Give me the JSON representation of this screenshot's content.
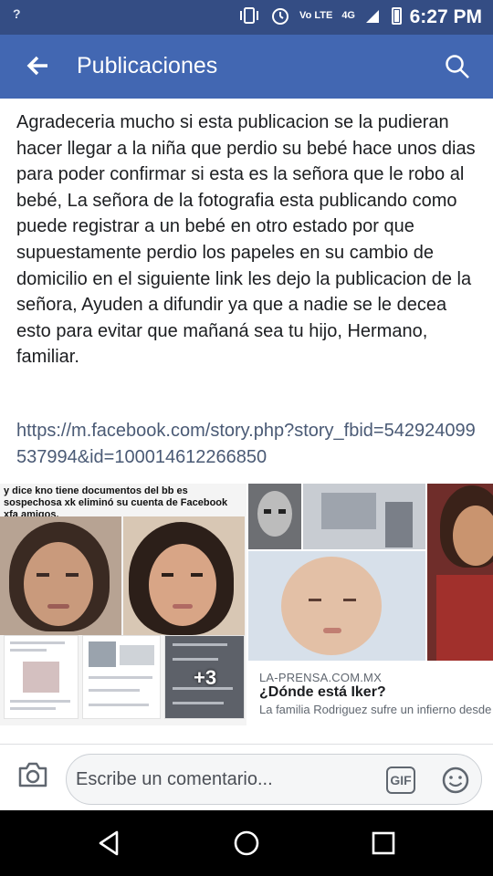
{
  "status_bar": {
    "signal_left": "?",
    "network": "Vo LTE",
    "network_4g": "4G",
    "time": "6:27 PM",
    "icons": [
      "vibrate-icon",
      "alarm-icon",
      "signal-icon",
      "battery-icon"
    ]
  },
  "app_bar": {
    "title": "Publicaciones",
    "back_icon": "arrow-left-icon",
    "search_icon": "search-icon",
    "background": "#4267b2"
  },
  "post": {
    "text": "Agradeceria mucho si esta publicacion se la pudieran hacer llegar a la niña que perdio su bebé hace unos dias para poder confirmar si esta es la señora que le robo al bebé, La señora de la fotografia esta publicando como puede registrar a un bebé en otro estado por que supuestamente perdio los papeles en su cambio de domicilio en el siguiente link les dejo la publicacion de la señora, Ayuden a difundir ya que a nadie se le decea esto para evitar que mañaná sea tu hijo, Hermano, familiar.",
    "link": "https://m.facebook.com/story.php?story_fbid=542924099537994&id=100014612266850"
  },
  "attachment_left": {
    "caption": "y dice kno tiene documentos del bb es sospechosa xk eliminó su cuenta de Facebook xfa amigos.",
    "more_count": "+3"
  },
  "link_preview": {
    "domain": "LA-PRENSA.COM.MX",
    "title": "¿Dónde está Iker?",
    "description": "La familia Rodriguez sufre un infierno desde"
  },
  "composer": {
    "placeholder": "Escribe un comentario...",
    "camera_icon": "camera-icon",
    "gif_label": "GIF",
    "emoji_icon": "smiley-icon"
  },
  "nav_bar": {
    "icons": [
      "back-triangle-icon",
      "home-circle-icon",
      "recents-square-icon"
    ]
  }
}
